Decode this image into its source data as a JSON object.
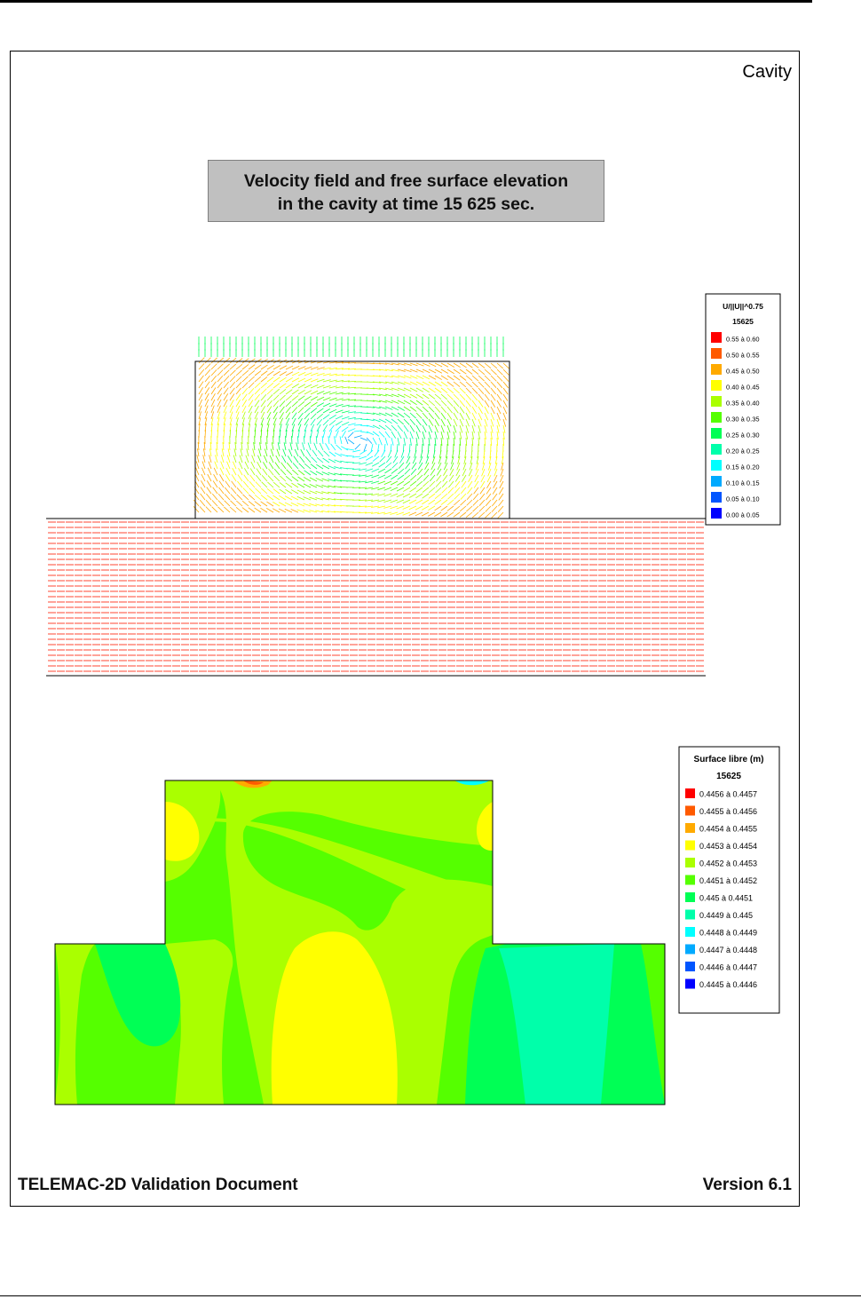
{
  "page": {
    "section_title": "Cavity",
    "caption_line1": "Velocity field and free surface elevation",
    "caption_line2": "in the cavity at time 15 625 sec.",
    "footer_left": "TELEMAC-2D Validation Document",
    "footer_right": "Version 6.1"
  },
  "velocity_legend": {
    "title": "U/||U||^0.75",
    "time": "15625",
    "entries": [
      {
        "label": "0.55  à   0.60",
        "color": "#ff0000"
      },
      {
        "label": "0.50  à   0.55",
        "color": "#ff5a00"
      },
      {
        "label": "0.45  à   0.50",
        "color": "#ffaa00"
      },
      {
        "label": "0.40  à   0.45",
        "color": "#ffff00"
      },
      {
        "label": "0.35  à   0.40",
        "color": "#aaff00"
      },
      {
        "label": "0.30  à   0.35",
        "color": "#55ff00"
      },
      {
        "label": "0.25  à   0.30",
        "color": "#00ff55"
      },
      {
        "label": "0.20  à   0.25",
        "color": "#00ffaa"
      },
      {
        "label": "0.15  à   0.20",
        "color": "#00ffff"
      },
      {
        "label": "0.10  à   0.15",
        "color": "#00aaff"
      },
      {
        "label": "0.05  à   0.10",
        "color": "#0055ff"
      },
      {
        "label": "0.00  à   0.05",
        "color": "#0000ff"
      }
    ]
  },
  "surface_legend": {
    "title": "Surface libre (m)",
    "time": "15625",
    "entries": [
      {
        "label": "0.4456 à  0.4457",
        "color": "#ff0000"
      },
      {
        "label": "0.4455 à  0.4456",
        "color": "#ff5a00"
      },
      {
        "label": "0.4454 à  0.4455",
        "color": "#ffaa00"
      },
      {
        "label": "0.4453 à  0.4454",
        "color": "#ffff00"
      },
      {
        "label": "0.4452 à  0.4453",
        "color": "#aaff00"
      },
      {
        "label": "0.4451 à  0.4452",
        "color": "#55ff00"
      },
      {
        "label": "0.445 à  0.4451",
        "color": "#00ff55"
      },
      {
        "label": "0.4449 à      0.445",
        "color": "#00ffaa"
      },
      {
        "label": "0.4448 à  0.4449",
        "color": "#00ffff"
      },
      {
        "label": "0.4447 à  0.4448",
        "color": "#00aaff"
      },
      {
        "label": "0.4446 à  0.4447",
        "color": "#0055ff"
      },
      {
        "label": "0.4445 à  0.4446",
        "color": "#0000ff"
      }
    ]
  }
}
